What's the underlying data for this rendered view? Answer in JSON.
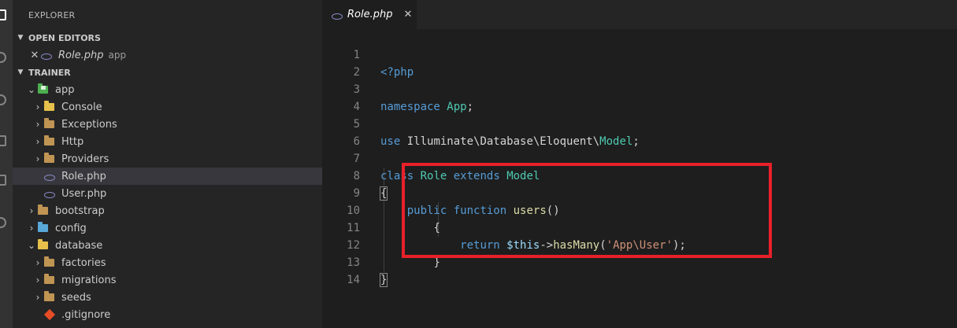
{
  "sidebar": {
    "title": "EXPLORER",
    "open_editors": {
      "header": "OPEN EDITORS",
      "items": [
        {
          "label": "Role.php",
          "desc": "app"
        }
      ]
    },
    "project": {
      "header": "TRAINER",
      "tree": [
        {
          "label": "app"
        },
        {
          "label": "Console"
        },
        {
          "label": "Exceptions"
        },
        {
          "label": "Http"
        },
        {
          "label": "Providers"
        },
        {
          "label": "Role.php"
        },
        {
          "label": "User.php"
        },
        {
          "label": "bootstrap"
        },
        {
          "label": "config"
        },
        {
          "label": "database"
        },
        {
          "label": "factories"
        },
        {
          "label": "migrations"
        },
        {
          "label": "seeds"
        },
        {
          "label": ".gitignore"
        }
      ]
    }
  },
  "editor": {
    "tab": {
      "label": "Role.php"
    },
    "line_numbers": [
      "1",
      "2",
      "3",
      "4",
      "5",
      "6",
      "7",
      "8",
      "9",
      "10",
      "11",
      "12",
      "13",
      "14"
    ],
    "code": {
      "l1": "<?php",
      "l3_ns": "namespace",
      "l3_name": "App",
      "l3_end": ";",
      "l5_use": "use",
      "l5_path": "Illuminate\\Database\\Eloquent\\",
      "l5_cls": "Model",
      "l5_end": ";",
      "l7_class": "class",
      "l7_name": "Role",
      "l7_extends": "extends",
      "l7_parent": "Model",
      "l8": "{",
      "l9_public": "public",
      "l9_function": "function",
      "l9_name": "users",
      "l9_parens": "()",
      "l10": "{",
      "l11_return": "return",
      "l11_this": "$this",
      "l11_arrow": "->",
      "l11_method": "hasMany",
      "l11_open": "(",
      "l11_str": "'App\\User'",
      "l11_close": ");",
      "l12": "}",
      "l13": "}"
    }
  },
  "colors": {
    "keyword": "#569cd6",
    "type": "#4ec9b0",
    "function": "#dcdcaa",
    "variable": "#9cdcfe",
    "string": "#ce9178",
    "highlight_box": "#e8202a"
  }
}
